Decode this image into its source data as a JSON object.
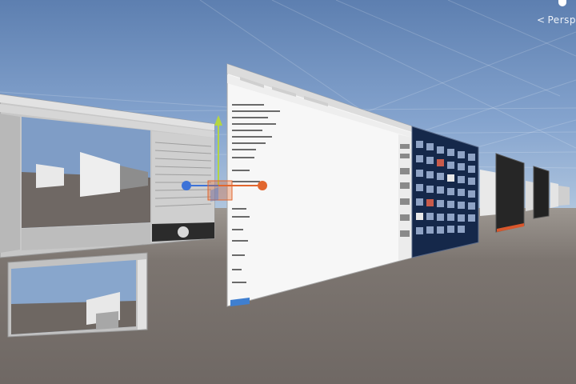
{
  "scene_view": {
    "projection_label": "Persp",
    "projection_icon": "chevron-left-icon",
    "sky_color": "#6b8cbd",
    "ground_color": "#7a7470"
  },
  "panels": [
    {
      "name": "unity-editor-panel",
      "content": "nested-scene-view"
    },
    {
      "name": "unity-game-view-panel",
      "content": "nested-scene-view"
    },
    {
      "name": "browser-window-panel",
      "content": "document-list"
    },
    {
      "name": "image-grid-panel",
      "content": "thumbnail-grid"
    },
    {
      "name": "dark-window-panel-1",
      "content": "dark"
    },
    {
      "name": "dark-window-panel-2",
      "content": "dark"
    },
    {
      "name": "far-window-panel",
      "content": "light"
    }
  ],
  "gizmo": {
    "name": "move-tool-gizmo",
    "x_axis_color": "#e2672f",
    "y_axis_color": "#b4d642",
    "z_axis_color": "#3d73d8"
  }
}
